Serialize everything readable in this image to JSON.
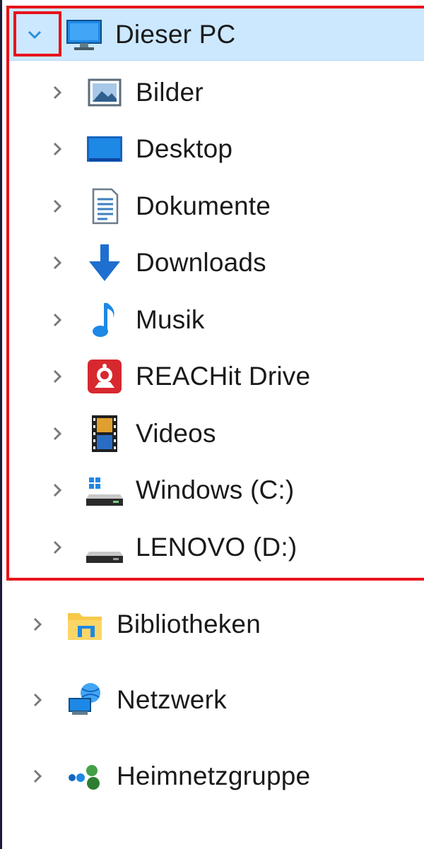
{
  "tree": {
    "root": {
      "label": "Dieser PC",
      "icon": "computer-icon",
      "expanded": true
    },
    "children": [
      {
        "label": "Bilder",
        "icon": "pictures-icon"
      },
      {
        "label": "Desktop",
        "icon": "desktop-icon"
      },
      {
        "label": "Dokumente",
        "icon": "documents-icon"
      },
      {
        "label": "Downloads",
        "icon": "downloads-icon"
      },
      {
        "label": "Musik",
        "icon": "music-icon"
      },
      {
        "label": "REACHit Drive",
        "icon": "reachit-drive-icon"
      },
      {
        "label": "Videos",
        "icon": "videos-icon"
      },
      {
        "label": "Windows (C:)",
        "icon": "windows-drive-icon"
      },
      {
        "label": "LENOVO (D:)",
        "icon": "drive-icon"
      }
    ],
    "siblings": [
      {
        "label": "Bibliotheken",
        "icon": "libraries-icon"
      },
      {
        "label": "Netzwerk",
        "icon": "network-icon"
      },
      {
        "label": "Heimnetzgruppe",
        "icon": "homegroup-icon"
      }
    ]
  },
  "colors": {
    "selection": "#cce8ff",
    "highlight": "#e8131b",
    "chevron_expanded": "#2a8fd6",
    "chevron": "#7a7a7a"
  }
}
